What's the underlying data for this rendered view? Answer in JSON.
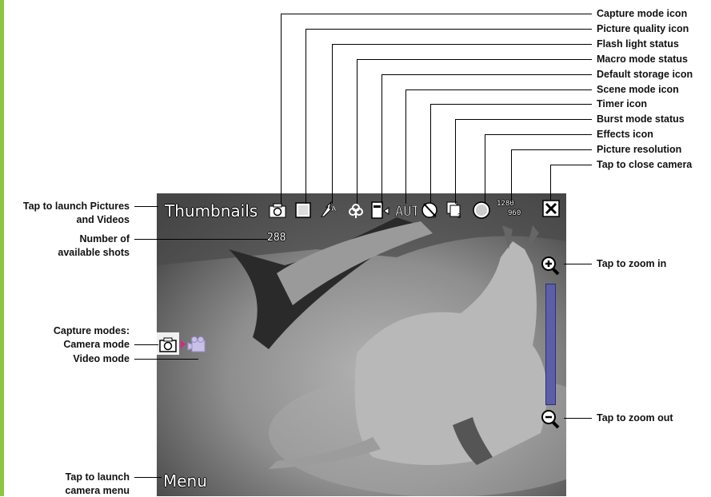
{
  "callouts_top": [
    "Capture mode icon",
    "Picture quality icon",
    "Flash light status",
    "Macro mode status",
    "Default storage icon",
    "Scene mode icon",
    "Timer icon",
    "Burst mode status",
    "Effects icon",
    "Picture resolution",
    "Tap to close camera"
  ],
  "callouts_left": {
    "thumbnails_line1": "Tap to launch Pictures",
    "thumbnails_line2": "and Videos",
    "shots_line1": "Number of",
    "shots_line2": "available shots",
    "modes_line1": "Capture modes:",
    "modes_line2": "Camera mode",
    "modes_line3": "Video mode",
    "menu_line1": "Tap to launch",
    "menu_line2": "camera menu"
  },
  "callouts_right": {
    "zoom_in": "Tap to zoom in",
    "zoom_out": "Tap to zoom out"
  },
  "screen": {
    "thumbnails": "Thumbnails",
    "shots": "288",
    "resolution_top": "1280",
    "resolution_bottom": "960",
    "menu": "Menu",
    "zoom_level": 0.0
  },
  "colors": {
    "accent_bar": "#8dc63f",
    "zoom_track": "#5c5fa8",
    "mode_arrow": "#e0208a"
  }
}
